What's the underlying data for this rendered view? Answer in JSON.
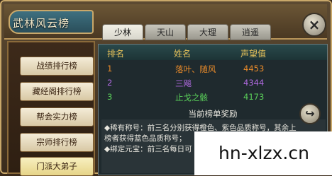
{
  "window": {
    "title": "武林风云榜",
    "close_icon": "×"
  },
  "tabs": [
    {
      "label": "少林",
      "active": true
    },
    {
      "label": "天山",
      "active": false
    },
    {
      "label": "大理",
      "active": false
    },
    {
      "label": "逍遥",
      "active": false
    }
  ],
  "sidebar": {
    "items": [
      {
        "label": "战绩排行榜"
      },
      {
        "label": "藏经阁排行榜"
      },
      {
        "label": "帮会实力榜"
      },
      {
        "label": "宗师排行榜"
      },
      {
        "label": "门派大弟子"
      }
    ]
  },
  "table": {
    "headers": {
      "rank": "排名",
      "name": "姓名",
      "score": "声望值"
    },
    "rows": [
      {
        "rank": "1",
        "name": "落叶、随风",
        "score": "4453",
        "color": "#e88a2a"
      },
      {
        "rank": "2",
        "name": "三飚",
        "score": "4344",
        "color": "#b06ae0"
      },
      {
        "rank": "3",
        "name": "止戈之骸",
        "score": "4173",
        "color": "#5ad05a"
      }
    ]
  },
  "reward": {
    "title": "当前榜单奖励",
    "line1": "◆稀有称号：前三名分别获得橙色、紫色品质称号，其余上",
    "line2": "榜者获得蓝色品质称号；",
    "line3": "◆绑定元宝：前三名每日可"
  },
  "nav": {
    "next_icon": "↪"
  },
  "watermark": "hn-xlzx.cn",
  "colors": {
    "accent": "#e6c25a",
    "frame": "#c9a86a"
  }
}
